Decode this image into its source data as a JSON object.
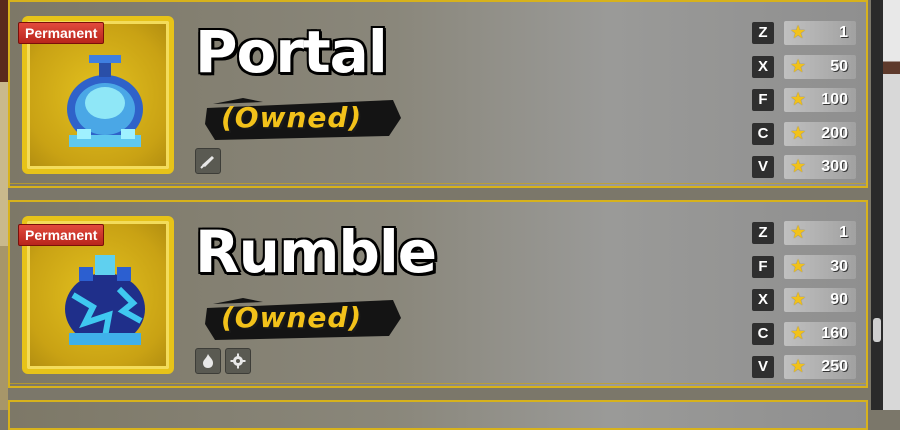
{
  "fruits": [
    {
      "name": "Portal",
      "badge": "Permanent",
      "status": "(Owned)",
      "chips": [
        "sword-icon"
      ],
      "moves": [
        {
          "key": "Z",
          "level": "1"
        },
        {
          "key": "X",
          "level": "50"
        },
        {
          "key": "F",
          "level": "100"
        },
        {
          "key": "C",
          "level": "200"
        },
        {
          "key": "V",
          "level": "300"
        }
      ]
    },
    {
      "name": "Rumble",
      "badge": "Permanent",
      "status": "(Owned)",
      "chips": [
        "fire-icon",
        "gear-icon"
      ],
      "moves": [
        {
          "key": "Z",
          "level": "1"
        },
        {
          "key": "F",
          "level": "30"
        },
        {
          "key": "X",
          "level": "90"
        },
        {
          "key": "C",
          "level": "160"
        },
        {
          "key": "V",
          "level": "250"
        }
      ]
    }
  ],
  "colors": {
    "accent_gold": "#d7b21c",
    "owned_text": "#f3c21a",
    "badge_red": "#c9302c"
  }
}
